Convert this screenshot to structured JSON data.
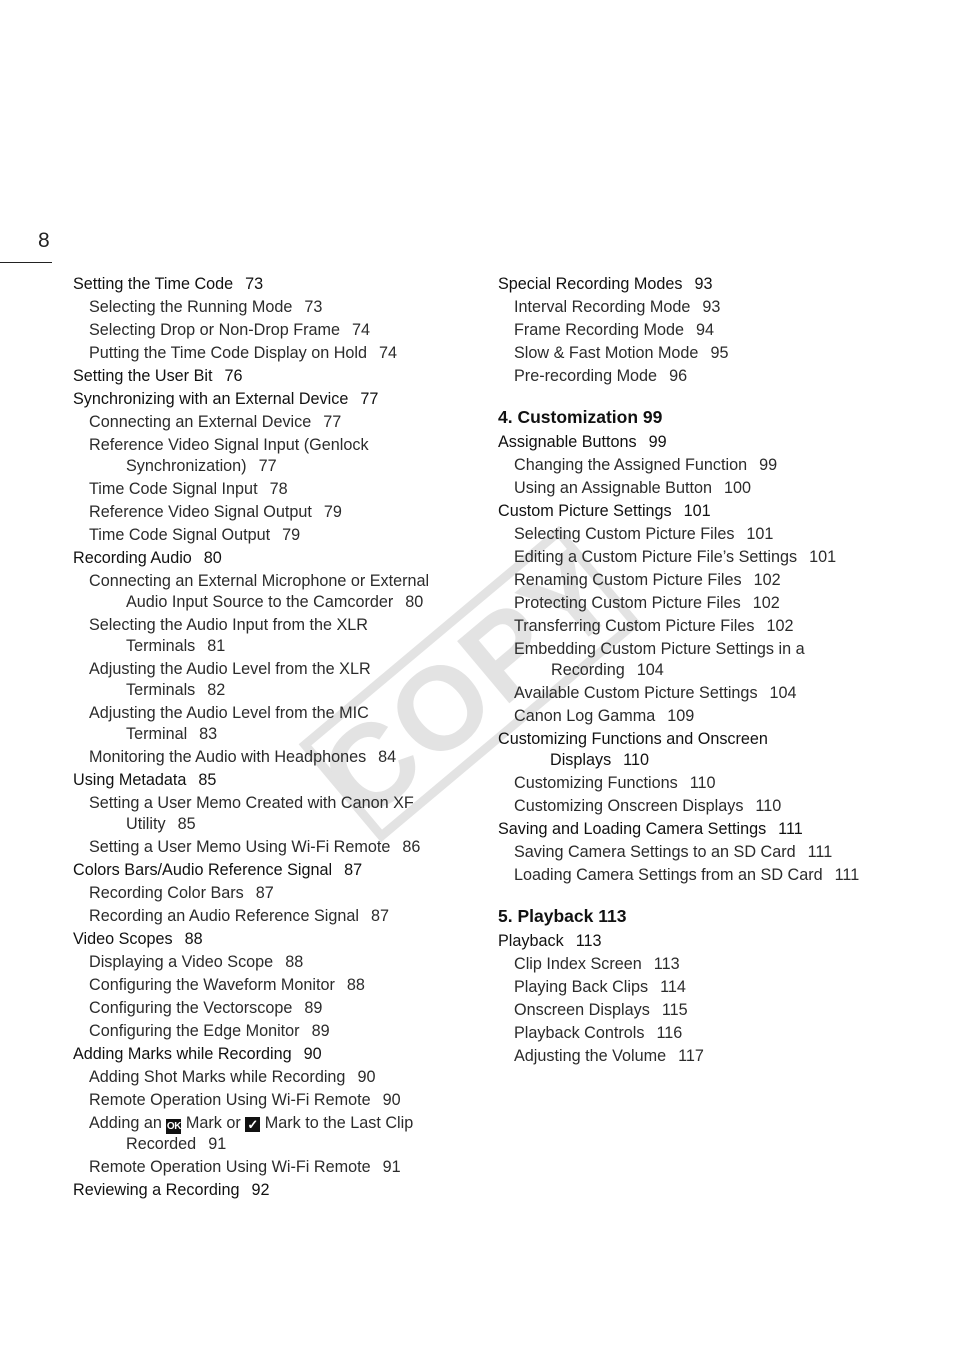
{
  "page": {
    "number": "8",
    "watermark": "COPY"
  },
  "left_column": [
    {
      "level": 1,
      "title": "Setting the Time Code",
      "page": "73"
    },
    {
      "level": 2,
      "title": "Selecting the Running Mode",
      "page": "73"
    },
    {
      "level": 2,
      "title": "Selecting Drop or Non-Drop Frame",
      "page": "74"
    },
    {
      "level": 2,
      "title": "Putting the Time Code Display on Hold",
      "page": "74"
    },
    {
      "level": 1,
      "title": "Setting the User Bit",
      "page": "76"
    },
    {
      "level": 1,
      "title": "Synchronizing with an External Device",
      "page": "77"
    },
    {
      "level": 2,
      "title": "Connecting an External Device",
      "page": "77"
    },
    {
      "level": 2,
      "title": "Reference Video Signal Input (Genlock",
      "title_cont": "Synchronization)",
      "page": "77"
    },
    {
      "level": 2,
      "title": "Time Code Signal Input",
      "page": "78"
    },
    {
      "level": 2,
      "title": "Reference Video Signal Output",
      "page": "79"
    },
    {
      "level": 2,
      "title": "Time Code Signal Output",
      "page": "79"
    },
    {
      "level": 1,
      "title": "Recording Audio",
      "page": "80"
    },
    {
      "level": 2,
      "title": "Connecting an External Microphone or External",
      "title_cont": "Audio Input Source to the Camcorder",
      "page": "80"
    },
    {
      "level": 2,
      "title": "Selecting the Audio Input from the XLR",
      "title_cont": "Terminals",
      "page": "81"
    },
    {
      "level": 2,
      "title": "Adjusting the Audio Level from the XLR",
      "title_cont": "Terminals",
      "page": "82"
    },
    {
      "level": 2,
      "title": "Adjusting the Audio Level from the MIC",
      "title_cont": "Terminal",
      "page": "83"
    },
    {
      "level": 2,
      "title": "Monitoring the Audio with Headphones",
      "page": "84"
    },
    {
      "level": 1,
      "title": "Using Metadata",
      "page": "85"
    },
    {
      "level": 2,
      "title": "Setting a User Memo Created with Canon XF",
      "title_cont": "Utility",
      "page": "85"
    },
    {
      "level": 2,
      "title": "Setting a User Memo Using Wi-Fi Remote",
      "page": "86"
    },
    {
      "level": 1,
      "title": "Colors Bars/Audio Reference Signal",
      "page": "87"
    },
    {
      "level": 2,
      "title": "Recording Color Bars",
      "page": "87"
    },
    {
      "level": 2,
      "title": "Recording an Audio Reference Signal",
      "page": "87"
    },
    {
      "level": 1,
      "title": "Video Scopes",
      "page": "88"
    },
    {
      "level": 2,
      "title": "Displaying a Video Scope",
      "page": "88"
    },
    {
      "level": 2,
      "title": "Configuring the Waveform Monitor",
      "page": "88"
    },
    {
      "level": 2,
      "title": "Configuring the Vectorscope",
      "page": "89"
    },
    {
      "level": 2,
      "title": "Configuring the Edge Monitor",
      "page": "89"
    },
    {
      "level": 1,
      "title": "Adding Marks while Recording",
      "page": "90"
    },
    {
      "level": 2,
      "title": "Adding Shot Marks while Recording",
      "page": "90"
    },
    {
      "level": 2,
      "title": "Remote Operation Using Wi-Fi Remote",
      "page": "90"
    },
    {
      "level": 2,
      "title_parts": [
        "Adding an",
        "Mark or",
        "Mark to the Last Clip"
      ],
      "icons": [
        "ok-mark-icon",
        "check-mark-icon"
      ],
      "icon_text": [
        "OK",
        "✓"
      ],
      "title_cont": "Recorded",
      "page": "91"
    },
    {
      "level": 2,
      "title": "Remote Operation Using Wi-Fi Remote",
      "page": "91"
    },
    {
      "level": 1,
      "title": "Reviewing a Recording",
      "page": "92"
    }
  ],
  "right_column": {
    "pre_section": [
      {
        "level": 1,
        "title": "Special Recording Modes",
        "page": "93"
      },
      {
        "level": 2,
        "title": "Interval Recording Mode",
        "page": "93"
      },
      {
        "level": 2,
        "title": "Frame Recording Mode",
        "page": "94"
      },
      {
        "level": 2,
        "title": "Slow & Fast Motion Mode",
        "page": "95"
      },
      {
        "level": 2,
        "title": "Pre-recording Mode",
        "page": "96"
      }
    ],
    "chapters": [
      {
        "heading": "4. Customization 99",
        "entries": [
          {
            "level": 1,
            "title": "Assignable Buttons",
            "page": "99"
          },
          {
            "level": 2,
            "title": "Changing the Assigned Function",
            "page": "99"
          },
          {
            "level": 2,
            "title": "Using an Assignable Button",
            "page": "100"
          },
          {
            "level": 1,
            "title": "Custom Picture Settings",
            "page": "101"
          },
          {
            "level": 2,
            "title": "Selecting Custom Picture Files",
            "page": "101"
          },
          {
            "level": 2,
            "title": "Editing a Custom Picture File’s Settings",
            "page": "101"
          },
          {
            "level": 2,
            "title": "Renaming Custom Picture Files",
            "page": "102"
          },
          {
            "level": 2,
            "title": "Protecting Custom Picture Files",
            "page": "102"
          },
          {
            "level": 2,
            "title": "Transferring Custom Picture Files",
            "page": "102"
          },
          {
            "level": 2,
            "title": "Embedding Custom Picture Settings in a",
            "title_cont": "Recording",
            "page": "104"
          },
          {
            "level": 2,
            "title": "Available Custom Picture Settings",
            "page": "104"
          },
          {
            "level": 2,
            "title": "Canon Log Gamma",
            "page": "109"
          },
          {
            "level": 1,
            "title": "Customizing Functions and Onscreen",
            "title_cont": "Displays",
            "page": "110"
          },
          {
            "level": 2,
            "title": "Customizing Functions",
            "page": "110"
          },
          {
            "level": 2,
            "title": "Customizing Onscreen Displays",
            "page": "110"
          },
          {
            "level": 1,
            "title": "Saving and Loading Camera Settings",
            "page": "111"
          },
          {
            "level": 2,
            "title": "Saving Camera Settings to an SD Card",
            "page": "111"
          },
          {
            "level": 2,
            "title": "Loading Camera Settings from an SD Card",
            "page": "111"
          }
        ]
      },
      {
        "heading": "5. Playback 113",
        "entries": [
          {
            "level": 1,
            "title": "Playback",
            "page": "113"
          },
          {
            "level": 2,
            "title": "Clip Index Screen",
            "page": "113"
          },
          {
            "level": 2,
            "title": "Playing Back Clips",
            "page": "114"
          },
          {
            "level": 2,
            "title": "Onscreen Displays",
            "page": "115"
          },
          {
            "level": 2,
            "title": "Playback Controls",
            "page": "116"
          },
          {
            "level": 2,
            "title": "Adjusting the Volume",
            "page": "117"
          }
        ]
      }
    ]
  }
}
